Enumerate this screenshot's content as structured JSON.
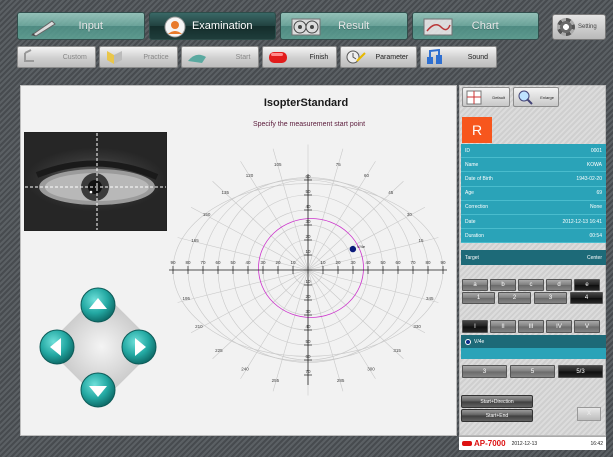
{
  "tabs": [
    {
      "label": "Input",
      "icon": "pen-icon",
      "active": false
    },
    {
      "label": "Examination",
      "icon": "examiner-icon",
      "active": true
    },
    {
      "label": "Result",
      "icon": "result-icon",
      "active": false
    },
    {
      "label": "Chart",
      "icon": "chart-icon",
      "active": false
    }
  ],
  "setting_label": "Setting",
  "toolbar": [
    {
      "label": "Custom",
      "icon": "custom-icon",
      "enabled": false
    },
    {
      "label": "Practice",
      "icon": "practice-icon",
      "enabled": false
    },
    {
      "label": "Start",
      "icon": "start-icon",
      "enabled": false
    },
    {
      "label": "Finish",
      "icon": "finish-icon",
      "enabled": true
    },
    {
      "label": "Parameter",
      "icon": "parameter-icon",
      "enabled": true
    },
    {
      "label": "Sound",
      "icon": "sound-icon",
      "enabled": true
    }
  ],
  "plot": {
    "title": "IsopterStandard",
    "subtitle": "Specify the measurement start point",
    "x_ticks": [
      "90",
      "80",
      "70",
      "60",
      "50",
      "40",
      "30",
      "20",
      "10",
      "10",
      "20",
      "30",
      "40",
      "50",
      "60",
      "70",
      "80",
      "90"
    ],
    "y_ticks_up": [
      "10",
      "20",
      "30",
      "40",
      "50",
      "60"
    ],
    "y_ticks_down": [
      "10",
      "20",
      "30",
      "40",
      "50",
      "60",
      "70"
    ],
    "angle_labels": [
      "105",
      "120",
      "135",
      "150",
      "165",
      "75",
      "60",
      "45",
      "30",
      "15",
      "195",
      "210",
      "225",
      "240",
      "255",
      "285",
      "300",
      "315",
      "330",
      "345"
    ],
    "marker": {
      "label": "V/4e",
      "angle_deg": 25,
      "radius_deg": 33
    },
    "colors": {
      "grid": "#c8c8c8",
      "axis": "#222222",
      "isopter": "#cc33cc",
      "marker": "#0b1a7a"
    }
  },
  "right_panel": {
    "default_label": "Default",
    "enlarge_label": "Enlarge",
    "eye": "R",
    "info": [
      {
        "key": "ID",
        "value": "0001"
      },
      {
        "key": "Name",
        "value": "KOWA"
      },
      {
        "key": "Date of Birth",
        "value": "1943-02-20"
      },
      {
        "key": "Age",
        "value": "69"
      },
      {
        "key": "Correction",
        "value": "None"
      },
      {
        "key": "Date",
        "value": "2012-12-13 16:41"
      },
      {
        "key": "Duration",
        "value": "00:54"
      }
    ],
    "target": {
      "key": "Target",
      "value": "Center"
    },
    "size_letters": [
      "a",
      "b",
      "c",
      "d",
      "e"
    ],
    "size_numbers": [
      "1",
      "2",
      "3",
      "4"
    ],
    "intensity": [
      "I",
      "II",
      "III",
      "IV",
      "V"
    ],
    "stimulus": "V/4e",
    "speed": [
      "3",
      "5",
      "5/3"
    ],
    "start_direction_label": "Start+Direction",
    "start_end_label": "Start+End",
    "close_label": "X"
  },
  "status": {
    "model": "AP-7000",
    "date": "2012-12-13",
    "time": "16:42"
  }
}
